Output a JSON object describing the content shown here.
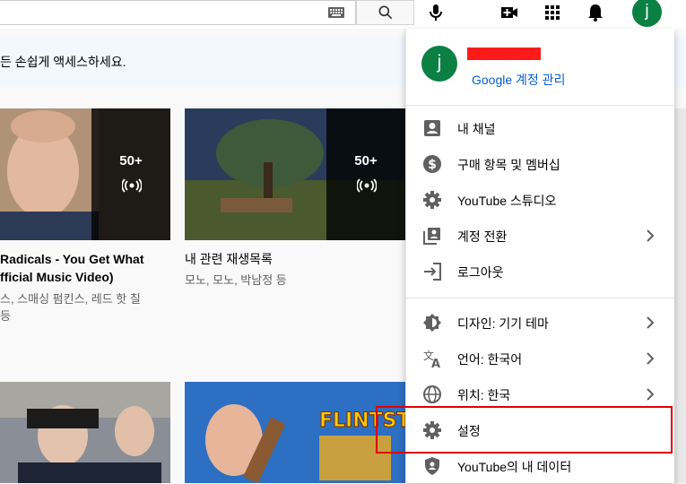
{
  "topbar": {
    "icons": [
      "keyboard-icon",
      "search-icon",
      "mic-icon",
      "create-video-icon",
      "apps-grid-icon",
      "notifications-bell-icon"
    ],
    "avatar_letter": "j"
  },
  "banner": {
    "text": "든 손쉽게 액세스하세요."
  },
  "videos": [
    {
      "title_line1": "Radicals - You Get What",
      "title_line2": "fficial Music Video)",
      "meta_line1": "스, 스매싱 펌킨스, 레드 핫 칠",
      "meta_line2": "등",
      "count": "50+"
    },
    {
      "title_line1": "내 관련 재생목록",
      "meta_line1": "모노, 모노, 박남정 등",
      "count": "50+"
    }
  ],
  "menu": {
    "avatar_letter": "j",
    "manage_account": "Google 계정 관리",
    "items": [
      {
        "label": "내 채널",
        "icon": "account-box-icon",
        "chevron": false
      },
      {
        "label": "구매 항목 및 멤버십",
        "icon": "dollar-circle-icon",
        "chevron": false
      },
      {
        "label": "YouTube 스튜디오",
        "icon": "gear-icon",
        "chevron": false
      },
      {
        "label": "계정 전환",
        "icon": "switch-account-icon",
        "chevron": true
      },
      {
        "label": "로그아웃",
        "icon": "sign-out-icon",
        "chevron": false
      },
      {
        "label": "디자인: 기기 테마",
        "icon": "theme-icon",
        "chevron": true
      },
      {
        "label": "언어: 한국어",
        "icon": "translate-icon",
        "chevron": true
      },
      {
        "label": "위치: 한국",
        "icon": "globe-icon",
        "chevron": true
      },
      {
        "label": "설정",
        "icon": "settings-gear-icon",
        "chevron": false
      },
      {
        "label": "YouTube의 내 데이터",
        "icon": "shield-user-icon",
        "chevron": false
      }
    ]
  },
  "colors": {
    "accent_blue": "#065fd4",
    "avatar_green": "#0b8043",
    "highlight_red": "#e00000"
  }
}
